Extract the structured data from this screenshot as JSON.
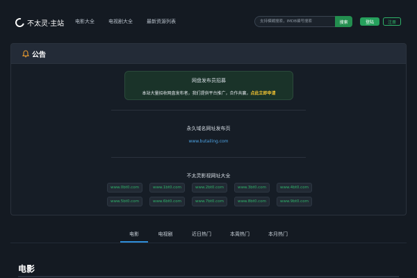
{
  "brand": {
    "name": "不太灵·主站"
  },
  "nav": {
    "items": [
      "电影大全",
      "电视剧大全",
      "最新资源列表"
    ]
  },
  "search": {
    "placeholder": "支持模糊搜索，IMDB编号搜索",
    "button_label": "搜索"
  },
  "auth": {
    "login_label": "登陆",
    "register_label": "注册"
  },
  "notice": {
    "title": "公告",
    "recruit_title": "网盘发布员招募",
    "recruit_text": "本站大量招收网盘发布者，我们提供平台推广，合作共赢，",
    "recruit_link": "点此立即申请",
    "perm_title": "永久域名网址发布页",
    "perm_url": "www.butailing.com",
    "sites_title": "不太灵影视网址大全",
    "sites": [
      "www.0bt0.com",
      "www.1bt0.com",
      "www.2bt0.com",
      "www.3bt0.com",
      "www.4bt0.com",
      "www.5bt0.com",
      "www.6bt0.com",
      "www.7bt0.com",
      "www.8bt0.com",
      "www.9bt0.com"
    ]
  },
  "tabs": {
    "items": [
      "电影",
      "电视剧",
      "近日热门",
      "本周热门",
      "本月热门"
    ],
    "active_index": 0
  },
  "section": {
    "title": "电影"
  },
  "colors": {
    "background": "#141a22",
    "accent_green": "#238e4f",
    "link_blue": "#4ea5e6",
    "highlight_yellow": "#f1c232",
    "tab_underline": "#2f8fdc"
  },
  "icons": {
    "logo": "brand-logo-icon",
    "notice": "bell-icon"
  }
}
